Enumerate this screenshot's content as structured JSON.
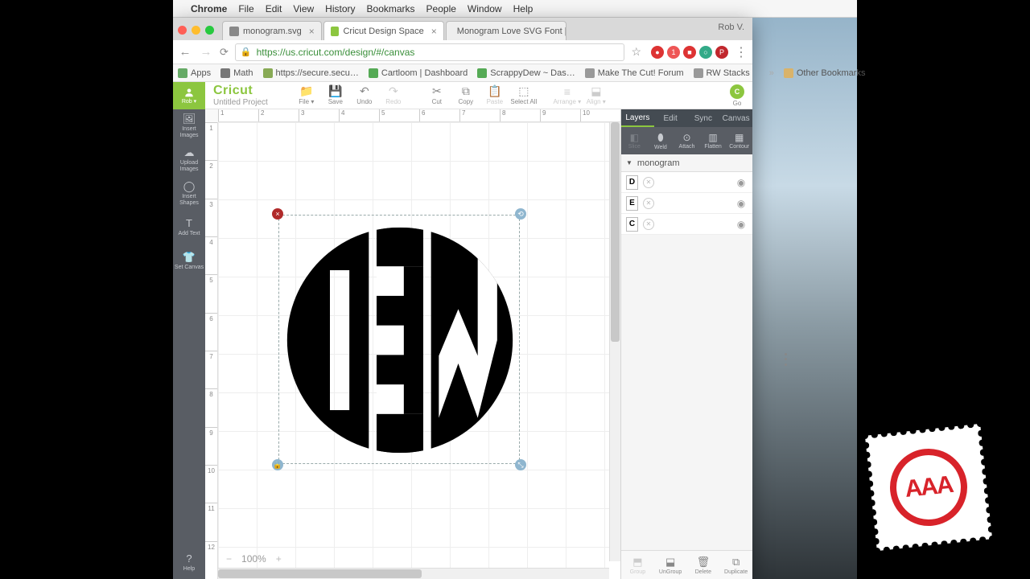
{
  "mac_menu": {
    "apple": "",
    "app": "Chrome",
    "items": [
      "File",
      "Edit",
      "View",
      "History",
      "Bookmarks",
      "People",
      "Window",
      "Help"
    ]
  },
  "chrome": {
    "tabs": [
      {
        "title": "monogram.svg",
        "favcolor": "#888"
      },
      {
        "title": "Cricut Design Space",
        "favcolor": "#8cc63f",
        "active": true
      },
      {
        "title": "Monogram Love SVG Font | L...",
        "favcolor": "#c66"
      }
    ],
    "user": "Rob V.",
    "url": "https://us.cricut.com/design/#/canvas",
    "bookmarks": [
      {
        "icon": "⋮⋮",
        "label": "Apps",
        "color": "#6a6"
      },
      {
        "icon": "∑",
        "label": "Math",
        "color": "#777"
      },
      {
        "icon": "$",
        "label": "https://secure.secu…",
        "color": "#8a5"
      },
      {
        "icon": "●",
        "label": "Cartloom | Dashboard",
        "color": "#5a5"
      },
      {
        "icon": "●",
        "label": "ScrappyDew ~ Das…",
        "color": "#5a5"
      },
      {
        "icon": "■",
        "label": "Make The Cut! Forum",
        "color": "#999"
      },
      {
        "icon": "▭",
        "label": "RW Stacks",
        "color": "#999"
      }
    ],
    "other_bookmarks": "Other Bookmarks",
    "extensions": [
      {
        "c": "#d33",
        "t": "●"
      },
      {
        "c": "#e55",
        "t": "1"
      },
      {
        "c": "#d33",
        "t": "■"
      },
      {
        "c": "#3a8",
        "t": "○"
      },
      {
        "c": "#c1272d",
        "t": "P"
      }
    ]
  },
  "app": {
    "brand": "Cricut",
    "project": "Untitled Project",
    "profile_label": "Rob ▾",
    "toolbar": [
      {
        "icon": "📁",
        "label": "File ▾",
        "enabled": true
      },
      {
        "icon": "💾",
        "label": "Save",
        "enabled": true
      },
      {
        "icon": "↶",
        "label": "Undo",
        "enabled": true
      },
      {
        "icon": "↷",
        "label": "Redo",
        "enabled": false
      },
      {
        "icon": "✂",
        "label": "Cut",
        "enabled": true
      },
      {
        "icon": "⧉",
        "label": "Copy",
        "enabled": true
      },
      {
        "icon": "📋",
        "label": "Paste",
        "enabled": false
      },
      {
        "icon": "⬚",
        "label": "Select All",
        "enabled": true
      },
      {
        "icon": "≡",
        "label": "Arrange ▾",
        "enabled": false
      },
      {
        "icon": "⬓",
        "label": "Align ▾",
        "enabled": false
      }
    ],
    "go_label": "Go",
    "left_tools": [
      {
        "icon": "🖼",
        "label": "Insert\nImages"
      },
      {
        "icon": "☁",
        "label": "Upload\nImages"
      },
      {
        "icon": "◯",
        "label": "Insert\nShapes"
      },
      {
        "icon": "T",
        "label": "Add Text"
      },
      {
        "icon": "👕",
        "label": "Set Canvas"
      }
    ],
    "help_label": "Help",
    "ruler_h": [
      "1",
      "2",
      "3",
      "4",
      "5",
      "6",
      "7",
      "8",
      "9",
      "10"
    ],
    "ruler_v": [
      "1",
      "2",
      "3",
      "4",
      "5",
      "6",
      "7",
      "8",
      "9",
      "10",
      "11",
      "12"
    ],
    "zoom": "100%",
    "panel_tabs": [
      "Layers",
      "Edit",
      "Sync",
      "Canvas"
    ],
    "panel_ops": [
      {
        "icon": "◧",
        "label": "Slice",
        "enabled": false
      },
      {
        "icon": "⬮",
        "label": "Weld",
        "enabled": true
      },
      {
        "icon": "⊙",
        "label": "Attach",
        "enabled": true
      },
      {
        "icon": "▥",
        "label": "Flatten",
        "enabled": true
      },
      {
        "icon": "▦",
        "label": "Contour",
        "enabled": true
      }
    ],
    "group_name": "monogram",
    "layers": [
      {
        "glyph": "D",
        "eye": "◉"
      },
      {
        "glyph": "E",
        "eye": "◉"
      },
      {
        "glyph": "C",
        "eye": "◉"
      }
    ],
    "bottom_ops": [
      {
        "icon": "⬒",
        "label": "Group",
        "enabled": false
      },
      {
        "icon": "⬓",
        "label": "UnGroup",
        "enabled": true
      },
      {
        "icon": "🗑",
        "label": "Delete",
        "enabled": true
      },
      {
        "icon": "⧉",
        "label": "Duplicate",
        "enabled": true
      }
    ]
  },
  "stamp_text": "AAA"
}
